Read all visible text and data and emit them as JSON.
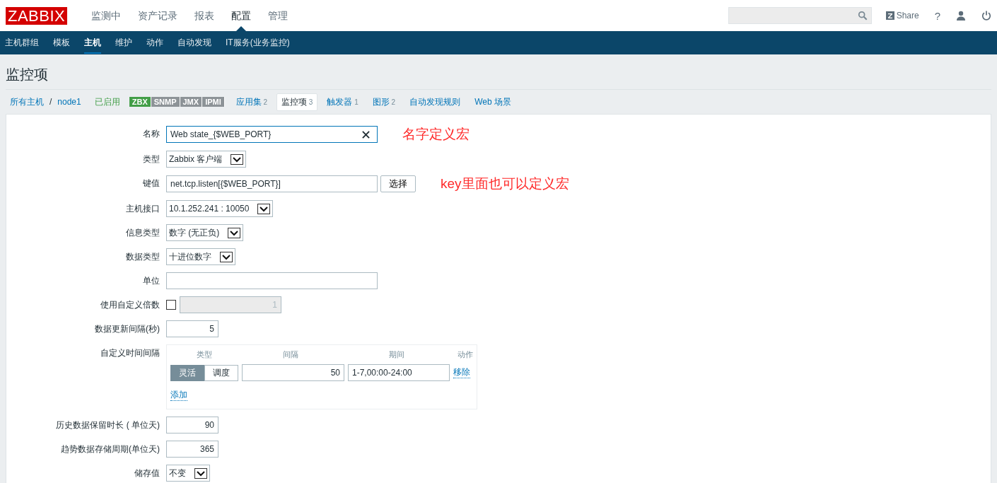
{
  "top_nav": {
    "logo": "ZABBIX",
    "items": [
      {
        "label": "监测中",
        "selected": false
      },
      {
        "label": "资产记录",
        "selected": false
      },
      {
        "label": "报表",
        "selected": false
      },
      {
        "label": "配置",
        "selected": true
      },
      {
        "label": "管理",
        "selected": false
      }
    ],
    "share": "Share",
    "help": "?"
  },
  "sub_nav": [
    {
      "label": "主机群组",
      "selected": false
    },
    {
      "label": "模板",
      "selected": false
    },
    {
      "label": "主机",
      "selected": true
    },
    {
      "label": "维护",
      "selected": false
    },
    {
      "label": "动作",
      "selected": false
    },
    {
      "label": "自动发现",
      "selected": false
    },
    {
      "label": "IT服务(业务监控)",
      "selected": false
    }
  ],
  "page_title": "监控项",
  "breadcrumb": {
    "links": [
      "所有主机",
      "node1"
    ],
    "separator": "/",
    "status": "已启用",
    "availability": [
      {
        "label": "ZBX",
        "on": true
      },
      {
        "label": "SNMP",
        "on": false
      },
      {
        "label": "JMX",
        "on": false
      },
      {
        "label": "IPMI",
        "on": false
      }
    ],
    "tabs": [
      {
        "label": "应用集",
        "count": "2",
        "selected": false
      },
      {
        "label": "监控项",
        "count": "3",
        "selected": true
      },
      {
        "label": "触发器",
        "count": "1",
        "selected": false
      },
      {
        "label": "图形",
        "count": "2",
        "selected": false
      },
      {
        "label": "自动发现规则",
        "selected": false
      },
      {
        "label": "Web 场景",
        "selected": false
      }
    ]
  },
  "form": [
    {
      "kind": "text",
      "label": "名称",
      "value": "Web state_{$WEB_PORT}",
      "focused": true,
      "clearable": true,
      "annotation": "名字定义宏"
    },
    {
      "kind": "select",
      "label": "类型",
      "value": "Zabbix 客户端"
    },
    {
      "kind": "text_button",
      "label": "键值",
      "value": "net.tcp.listen[{$WEB_PORT}]",
      "button": "选择",
      "annotation": "key里面也可以定义宏"
    },
    {
      "kind": "select",
      "label": "主机接口",
      "value": "10.1.252.241 : 10050"
    },
    {
      "kind": "select",
      "label": "信息类型",
      "value": "数字 (无正负)"
    },
    {
      "kind": "select",
      "label": "数据类型",
      "value": "十进位数字"
    },
    {
      "kind": "text",
      "label": "单位",
      "focused": false,
      "clearable": false
    },
    {
      "kind": "checkbox_number",
      "label": "使用自定义倍数",
      "checked": false,
      "value": "1"
    },
    {
      "kind": "number",
      "label": "数据更新间隔(秒)",
      "value": "5"
    },
    {
      "kind": "intervals",
      "label": "自定义时间间隔",
      "columns": [
        "类型",
        "间隔",
        "期间",
        "动作"
      ],
      "rows": [
        {
          "modes": [
            {
              "label": "灵活",
              "selected": true
            },
            {
              "label": "调度",
              "selected": false
            }
          ],
          "interval": "50",
          "period": "1-7,00:00-24:00",
          "action": "移除"
        }
      ],
      "add": "添加"
    },
    {
      "kind": "number",
      "label": "历史数据保留时长 ( 单位天)",
      "value": "90"
    },
    {
      "kind": "number",
      "label": "趋势数据存储周期(单位天)",
      "value": "365"
    },
    {
      "kind": "select",
      "label": "储存值",
      "value": "不变"
    }
  ]
}
